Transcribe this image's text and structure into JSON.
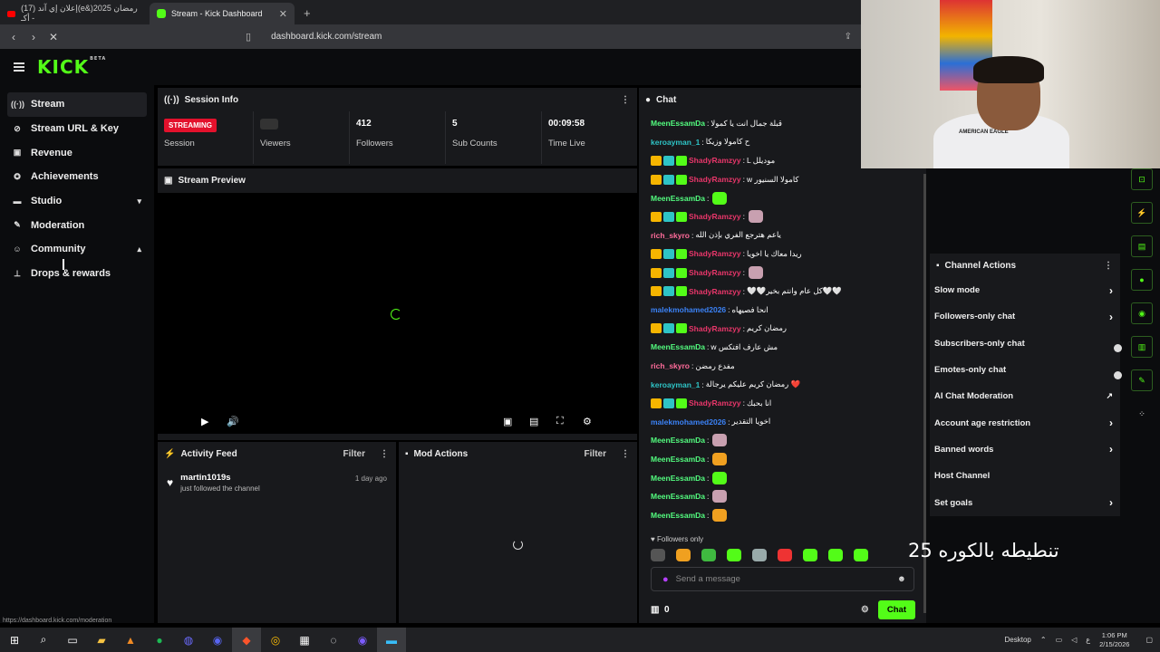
{
  "browser": {
    "tab1_title": "(17) إعلان إي آند(e&)رمضان 2025 - أكـ",
    "tab2_title": "Stream - Kick Dashboard",
    "url": "dashboard.kick.com/stream",
    "status_url": "https://dashboard.kick.com/moderation"
  },
  "app": {
    "logo": "KICK",
    "beta": "BETA"
  },
  "sidebar": {
    "items": [
      {
        "label": "Stream",
        "icon": "broadcast-icon"
      },
      {
        "label": "Stream URL & Key",
        "icon": "link-icon"
      },
      {
        "label": "Revenue",
        "icon": "revenue-icon"
      },
      {
        "label": "Achievements",
        "icon": "trophy-icon"
      },
      {
        "label": "Studio",
        "icon": "studio-icon"
      },
      {
        "label": "Moderation",
        "icon": "wrench-icon"
      },
      {
        "label": "Community",
        "icon": "community-icon"
      },
      {
        "label": "Drops & rewards",
        "icon": "gift-icon"
      }
    ]
  },
  "session": {
    "title": "Session Info",
    "status": "STREAMING",
    "status_label": "Session",
    "viewers_label": "Viewers",
    "followers": "412",
    "followers_label": "Followers",
    "subs": "5",
    "subs_label": "Sub Counts",
    "time": "00:09:58",
    "time_label": "Time Live"
  },
  "preview": {
    "title": "Stream Preview"
  },
  "activity": {
    "title": "Activity Feed",
    "filter": "Filter",
    "items": [
      {
        "user": "martin1019s",
        "action": "just followed the channel",
        "when": "1 day ago"
      }
    ]
  },
  "mod": {
    "title": "Mod Actions",
    "filter": "Filter"
  },
  "chat": {
    "title": "Chat",
    "messages": [
      {
        "user": "MeenEssamDa",
        "color": "#53fc7f",
        "badges": 0,
        "text": "قبلة جمال انت يا كمولا"
      },
      {
        "user": "keroayman_1",
        "color": "#2ec4c6",
        "badges": 0,
        "text": "ح كامولا وزيكا"
      },
      {
        "user": "ShadyRamzyy",
        "color": "#e8366a",
        "badges": 3,
        "text": "L موديلل"
      },
      {
        "user": "ShadyRamzyy",
        "color": "#e8366a",
        "badges": 3,
        "text": "w كامولا السنيور"
      },
      {
        "user": "MeenEssamDa",
        "color": "#53fc7f",
        "badges": 0,
        "text": ""
      },
      {
        "user": "ShadyRamzyy",
        "color": "#e8366a",
        "badges": 3,
        "text": ""
      },
      {
        "user": "rich_skyro",
        "color": "#ff6b9a",
        "badges": 0,
        "text": "ياعم هترجع الفري بإذن الله"
      },
      {
        "user": "ShadyRamzyy",
        "color": "#e8366a",
        "badges": 3,
        "text": "ريدا معاك يا اخويا"
      },
      {
        "user": "ShadyRamzyy",
        "color": "#e8366a",
        "badges": 3,
        "text": ""
      },
      {
        "user": "ShadyRamzyy",
        "color": "#e8366a",
        "badges": 3,
        "text": "🤍🤍كل عام وانتم بخير🤍🤍"
      },
      {
        "user": "malekmohamed2026",
        "color": "#3b82f6",
        "badges": 0,
        "text": "انحا فصيهاه"
      },
      {
        "user": "ShadyRamzyy",
        "color": "#e8366a",
        "badges": 3,
        "text": "رمضان كريم"
      },
      {
        "user": "MeenEssamDa",
        "color": "#53fc7f",
        "badges": 0,
        "text": "w مش عارف افتكس"
      },
      {
        "user": "rich_skyro",
        "color": "#ff6b9a",
        "badges": 0,
        "text": "مفدع رمضن"
      },
      {
        "user": "keroayman_1",
        "color": "#2ec4c6",
        "badges": 0,
        "text": "رمضان كريم عليكم يرجالة ❤️"
      },
      {
        "user": "ShadyRamzyy",
        "color": "#e8366a",
        "badges": 3,
        "text": "انا بحبك"
      },
      {
        "user": "malekmohamed2026",
        "color": "#3b82f6",
        "badges": 0,
        "text": "اخويا التقدير"
      },
      {
        "user": "MeenEssamDa",
        "color": "#53fc7f",
        "badges": 0,
        "text": ""
      },
      {
        "user": "MeenEssamDa",
        "color": "#53fc7f",
        "badges": 0,
        "text": ""
      },
      {
        "user": "MeenEssamDa",
        "color": "#53fc7f",
        "badges": 0,
        "text": ""
      },
      {
        "user": "MeenEssamDa",
        "color": "#53fc7f",
        "badges": 0,
        "text": ""
      },
      {
        "user": "MeenEssamDa",
        "color": "#53fc7f",
        "badges": 0,
        "text": ""
      }
    ],
    "followers_only": "Followers only",
    "placeholder": "Send a message",
    "points": "0",
    "send_label": "Chat"
  },
  "actions": {
    "title": "Channel Actions",
    "items": [
      {
        "label": "Slow mode",
        "ctrl": "chevron"
      },
      {
        "label": "Followers-only chat",
        "ctrl": "chevron"
      },
      {
        "label": "Subscribers-only chat",
        "ctrl": "toggle"
      },
      {
        "label": "Emotes-only chat",
        "ctrl": "toggle"
      },
      {
        "label": "AI Chat Moderation",
        "ctrl": "chart"
      },
      {
        "label": "Account age restriction",
        "ctrl": "chevron"
      },
      {
        "label": "Banned words",
        "ctrl": "chevron"
      },
      {
        "label": "Host Channel",
        "ctrl": "none"
      },
      {
        "label": "Set goals",
        "ctrl": "chevron"
      }
    ]
  },
  "overlay_text": "تنطيطه بالكوره 25",
  "webcam_shirt": "AMERICAN EAGLE",
  "taskbar": {
    "desktop": "Desktop",
    "lang": "ع",
    "time": "1:06 PM",
    "date": "2/15/2026"
  },
  "colors": {
    "accent": "#53fc18",
    "live": "#e3112c",
    "panel": "#18191c"
  }
}
